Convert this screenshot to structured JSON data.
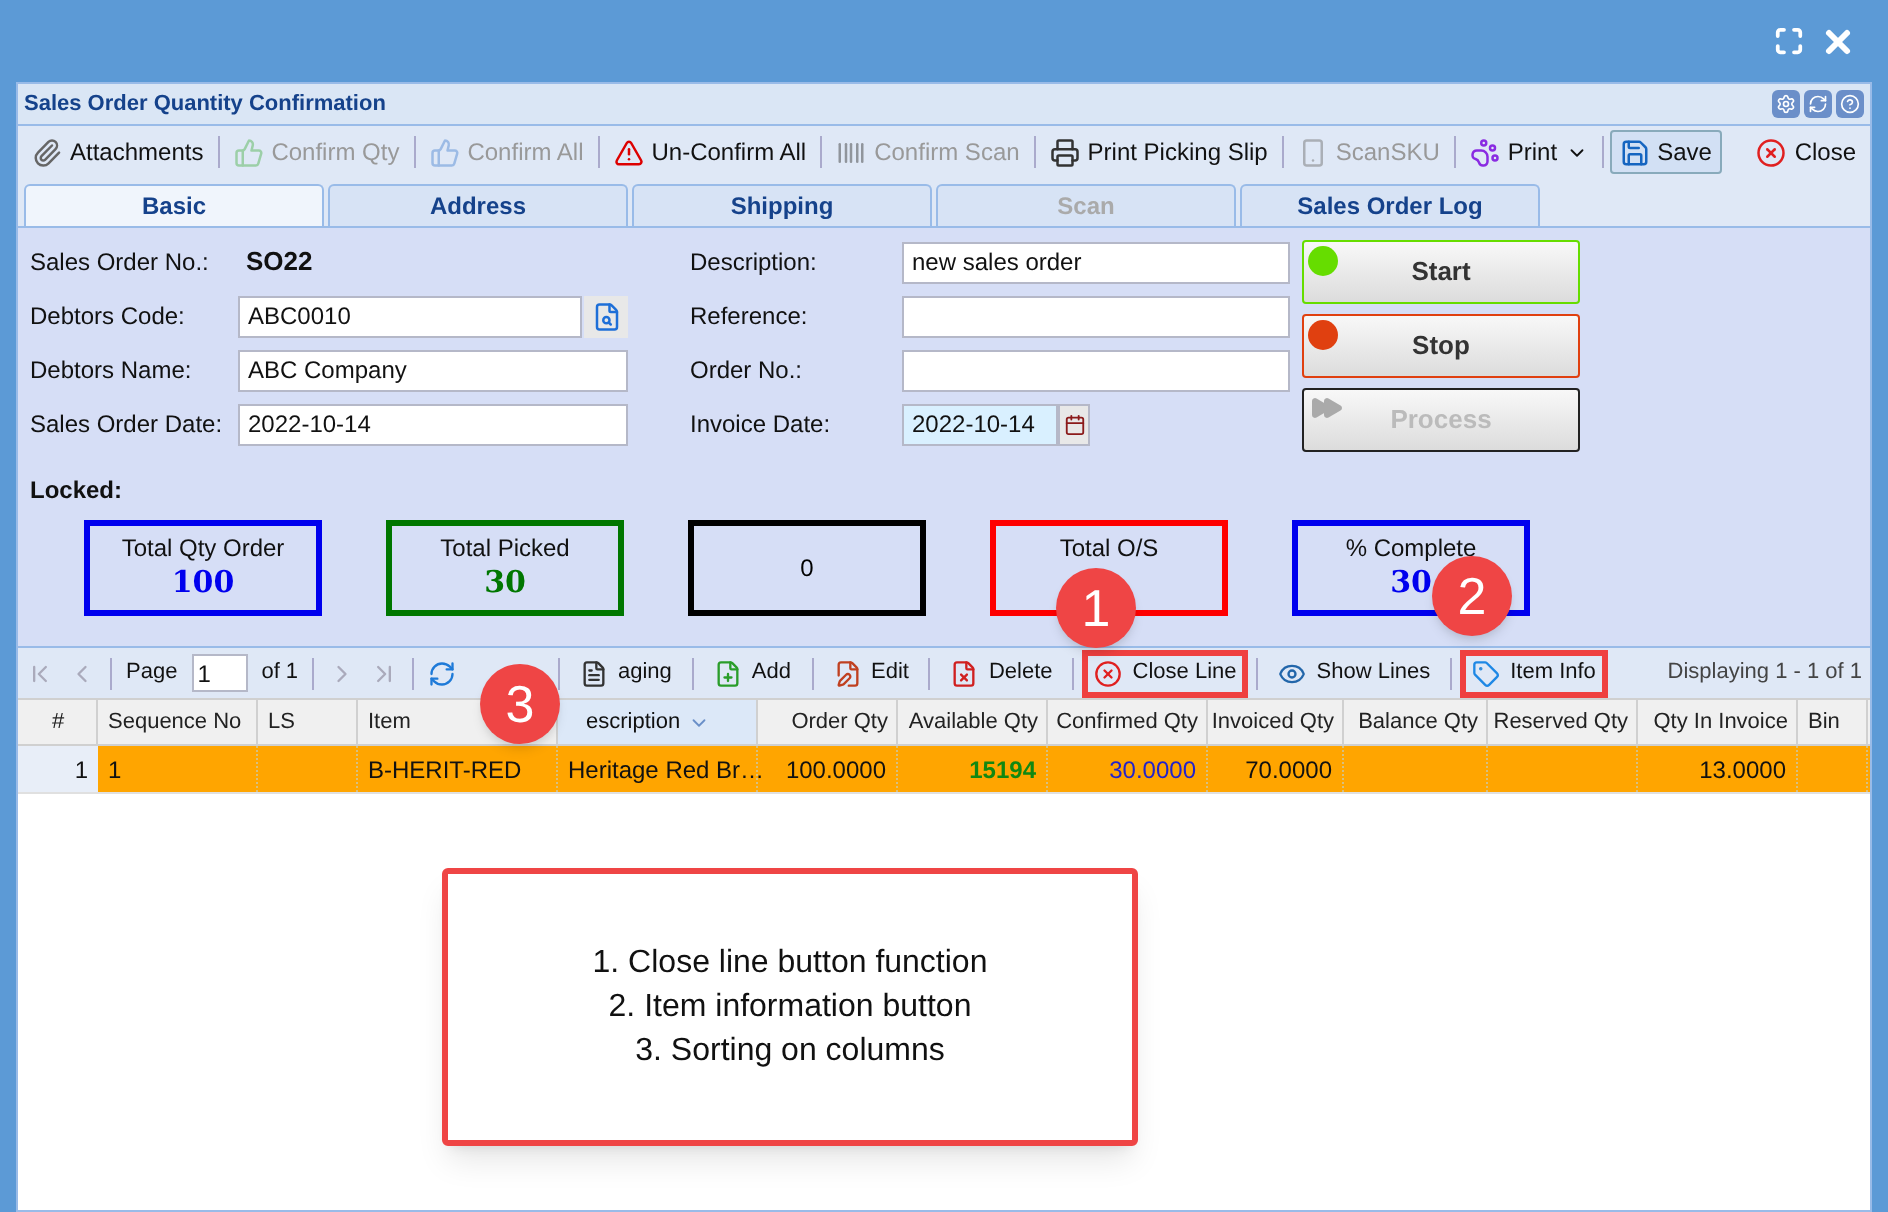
{
  "window": {
    "title": "Sales Order Quantity Confirmation"
  },
  "toolbar": [
    {
      "label": "Attachments",
      "kind": "plain",
      "disabled": false
    },
    {
      "label": "Confirm Qty",
      "kind": "plain",
      "disabled": true
    },
    {
      "label": "Confirm All",
      "kind": "plain",
      "disabled": true
    },
    {
      "label": "Un-Confirm All",
      "kind": "plain",
      "disabled": false
    },
    {
      "label": "Confirm Scan",
      "kind": "plain",
      "disabled": true
    },
    {
      "label": "Print Picking Slip",
      "kind": "plain",
      "disabled": false
    },
    {
      "label": "ScanSKU",
      "kind": "plain",
      "disabled": true
    },
    {
      "label": "Print",
      "kind": "menu",
      "disabled": false
    },
    {
      "label": "Save",
      "kind": "pressed",
      "disabled": false
    },
    {
      "label": "Close",
      "kind": "end",
      "disabled": false
    }
  ],
  "tabs": [
    {
      "label": "Basic",
      "selected": true,
      "disabled": false
    },
    {
      "label": "Address",
      "selected": false,
      "disabled": false
    },
    {
      "label": "Shipping",
      "selected": false,
      "disabled": false
    },
    {
      "label": "Scan",
      "selected": false,
      "disabled": true
    },
    {
      "label": "Sales Order Log",
      "selected": false,
      "disabled": false
    }
  ],
  "form": {
    "left": [
      {
        "label": "Sales Order No.:",
        "value": "SO22",
        "kind": "static"
      },
      {
        "label": "Debtors Code:",
        "value": "ABC0010",
        "kind": "lookup"
      },
      {
        "label": "Debtors Name:",
        "value": "ABC Company",
        "kind": "text"
      },
      {
        "label": "Sales Order Date:",
        "value": "2022-10-14",
        "kind": "text"
      }
    ],
    "right": [
      {
        "label": "Description:",
        "value": "new sales order",
        "kind": "text"
      },
      {
        "label": "Reference:",
        "kind": "text"
      },
      {
        "label": "Order No.:",
        "kind": "text"
      },
      {
        "label": "Invoice Date:",
        "value": "2022-10-14",
        "kind": "date"
      }
    ],
    "buttons": [
      {
        "label": "Start",
        "color": "#66dd00",
        "kind": "dot",
        "disabled": false
      },
      {
        "label": "Stop",
        "color": "#e04010",
        "kind": "dot",
        "disabled": false
      },
      {
        "label": "Process",
        "kind": "arrows",
        "disabled": true
      }
    ],
    "locked_label": "Locked:"
  },
  "summary": [
    {
      "label": "Total Qty Order",
      "value": "100",
      "color": "#0000ee"
    },
    {
      "label": "Total Picked",
      "value": "30",
      "color": "#007700"
    },
    {
      "value": "0",
      "color": "#000000"
    },
    {
      "label": "Total O/S",
      "color": "#ff0000"
    },
    {
      "label": "% Complete",
      "value": "30",
      "color": "#0000ee"
    }
  ],
  "pagingbar": {
    "page_label": "Page",
    "page": "1",
    "of": "of 1",
    "display": "Displaying 1 - 1 of 1",
    "buttons": [
      {
        "label": "aging",
        "highlighted": false
      },
      {
        "label": "Add",
        "highlighted": false
      },
      {
        "label": "Edit",
        "highlighted": false
      },
      {
        "label": "Delete",
        "highlighted": false
      },
      {
        "label": "Close Line",
        "highlighted": true
      },
      {
        "label": "Show Lines",
        "highlighted": false
      },
      {
        "label": "Item Info",
        "highlighted": true
      }
    ]
  },
  "grid": {
    "columns": [
      {
        "label": "#",
        "sorted": false
      },
      {
        "label": "Sequence No",
        "sorted": false
      },
      {
        "label": "LS",
        "sorted": false
      },
      {
        "label": "Item",
        "sorted": false
      },
      {
        "label": "escription",
        "sorted": true
      },
      {
        "label": "Order Qty",
        "sorted": false
      },
      {
        "label": "Available Qty",
        "sorted": false
      },
      {
        "label": "Confirmed Qty",
        "sorted": false
      },
      {
        "label": "Invoiced Qty",
        "sorted": false
      },
      {
        "label": "Balance Qty",
        "sorted": false
      },
      {
        "label": "Reserved Qty",
        "sorted": false
      },
      {
        "label": "Qty In Invoice",
        "sorted": false
      },
      {
        "label": "Bin",
        "sorted": false
      }
    ],
    "rows": [
      {
        "selected": true,
        "cells": [
          {
            "text": "1",
            "kind": "number"
          },
          {
            "text": "1",
            "kind": "plain"
          },
          {
            "text": "",
            "kind": "plain"
          },
          {
            "text": "B-HERIT-RED",
            "kind": "plain"
          },
          {
            "text": "Heritage Red Br…",
            "kind": "plain"
          },
          {
            "text": "100.0000",
            "kind": "plain"
          },
          {
            "text": "15194",
            "kind": "available"
          },
          {
            "text": "30.0000",
            "kind": "confirmed"
          },
          {
            "text": "70.0000",
            "kind": "plain"
          },
          {
            "text": "",
            "kind": "plain"
          },
          {
            "text": "",
            "kind": "plain"
          },
          {
            "text": "13.0000",
            "kind": "plain"
          },
          {
            "text": "",
            "kind": "plain"
          }
        ]
      }
    ]
  },
  "annotations": {
    "badges": [
      "1",
      "2",
      "3"
    ],
    "callout": [
      "1. Close line button function",
      "2. Item information button",
      "3. Sorting on columns"
    ]
  }
}
